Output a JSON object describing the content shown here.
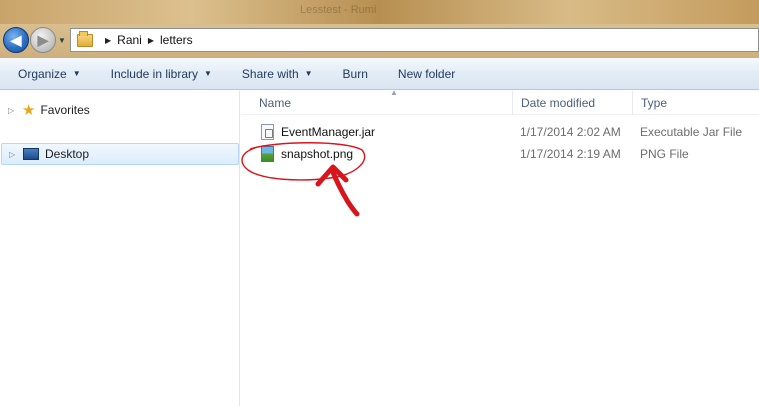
{
  "window": {
    "ghost_title": "Lesstest - Rumi"
  },
  "address": {
    "crumbs": [
      "Rani",
      "letters"
    ]
  },
  "toolbar": {
    "organize": "Organize",
    "include_in_library": "Include in library",
    "share_with": "Share with",
    "burn": "Burn",
    "new_folder": "New folder"
  },
  "nav": {
    "favorites": "Favorites",
    "desktop": "Desktop"
  },
  "columns": {
    "name": "Name",
    "date_modified": "Date modified",
    "type": "Type"
  },
  "files": [
    {
      "name": "EventManager.jar",
      "date": "1/17/2014 2:02 AM",
      "type": "Executable Jar File",
      "icon": "jar-file-icon"
    },
    {
      "name": "snapshot.png",
      "date": "1/17/2014 2:19 AM",
      "type": "PNG File",
      "icon": "png-file-icon"
    }
  ],
  "annotation": {
    "color": "#d8141d",
    "shape": "hand-drawn ellipse around snapshot.png with upward arrow"
  }
}
